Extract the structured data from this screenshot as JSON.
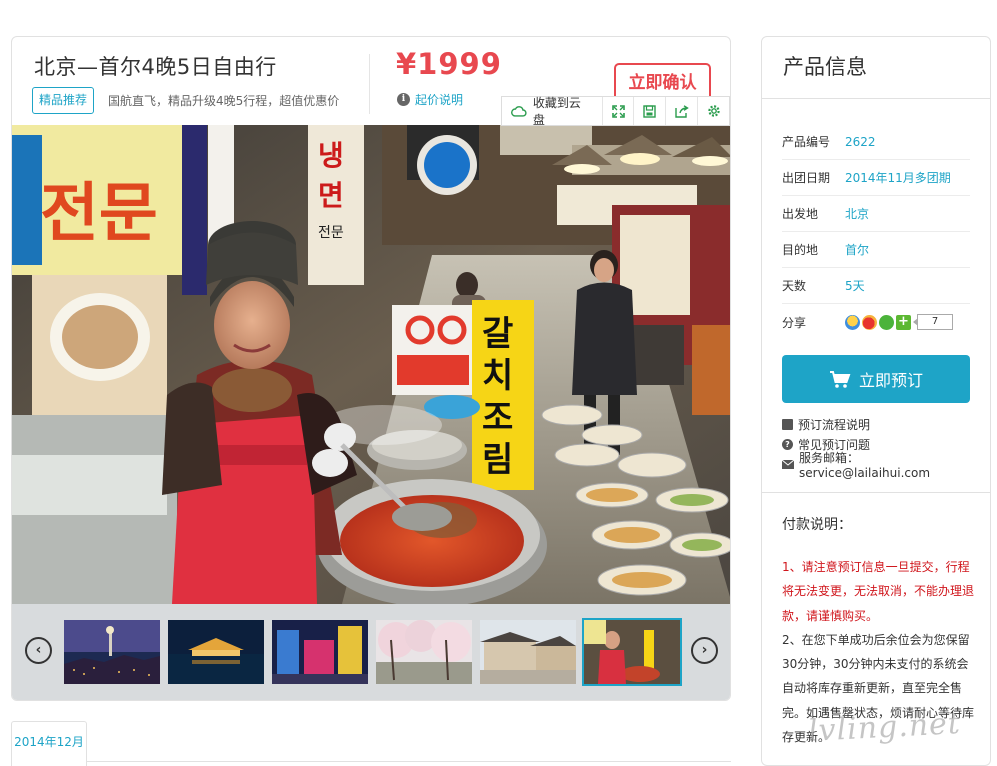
{
  "product": {
    "title": "北京—首尔4晚5日自由行",
    "badge": "精品推荐",
    "subtitle": "国航直飞，精品升级4晚5行程，超值优惠价",
    "price": "¥1999",
    "price_note": "起价说明",
    "confirm_label": "立即确认"
  },
  "toolbar": {
    "save_cloud": "收藏到云盘"
  },
  "thumbnails": {
    "count": 6,
    "active_index": 5
  },
  "date_tab": "2014年12月",
  "side": {
    "heading": "产品信息",
    "rows": [
      {
        "key": "产品编号",
        "value": "2622"
      },
      {
        "key": "出团日期",
        "value": "2014年11月多团期"
      },
      {
        "key": "出发地",
        "value": "北京"
      },
      {
        "key": "目的地",
        "value": "首尔"
      },
      {
        "key": "天数",
        "value": "5天"
      }
    ],
    "share_label": "分享",
    "share_count": "7",
    "book_label": "立即预订",
    "links": {
      "process": "预订流程说明",
      "faq": "常见预订问题",
      "email": "服务邮箱：service@lailaihui.com"
    },
    "pay_title": "付款说明：",
    "pay_1": "1、请注意预订信息一旦提交，行程将无法变更，无法取消，不能办理退款，请谨慎购买。",
    "pay_2": "2、在您下单成功后余位会为您保留30分钟，30分钟内未支付的系统会自动将库存重新更新，直至完全售完。如遇售罄状态，烦请耐心等待库存更新。"
  },
  "watermark": "lvling.net",
  "colors": {
    "accent": "#1ea4c7",
    "price": "#e8484f",
    "warning": "#d0161c"
  }
}
